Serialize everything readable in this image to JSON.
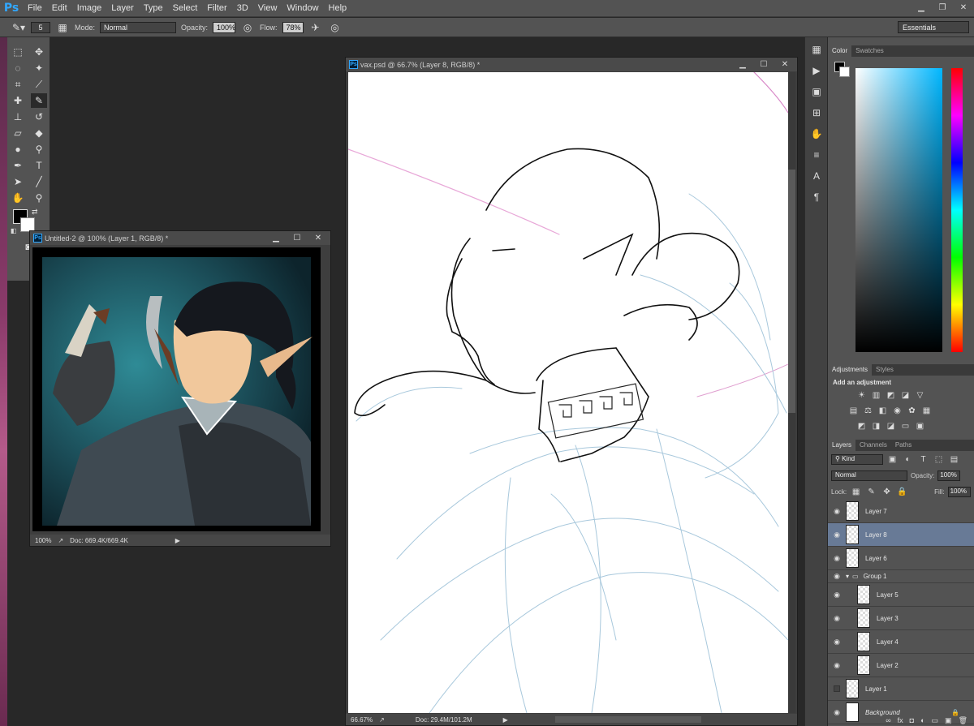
{
  "menu": {
    "logo": "Ps",
    "items": [
      "File",
      "Edit",
      "Image",
      "Layer",
      "Type",
      "Select",
      "Filter",
      "3D",
      "View",
      "Window",
      "Help"
    ]
  },
  "options": {
    "brush_size": "5",
    "mode_label": "Mode:",
    "mode_value": "Normal",
    "opacity_label": "Opacity:",
    "opacity_value": "100%",
    "flow_label": "Flow:",
    "flow_value": "78%",
    "workspace": "Essentials"
  },
  "doc_small": {
    "title": "Untitled-2 @ 100% (Layer 1, RGB/8) *",
    "zoom": "100%",
    "doc_info": "Doc: 669.4K/669.4K"
  },
  "doc_main": {
    "title": "vax.psd @ 66.7% (Layer 8, RGB/8) *",
    "zoom": "66.67%",
    "doc_info": "Doc: 29.4M/101.2M"
  },
  "color_panel": {
    "tabs": [
      "Color",
      "Swatches"
    ]
  },
  "adjust_panel": {
    "tabs": [
      "Adjustments",
      "Styles"
    ],
    "heading": "Add an adjustment"
  },
  "layers_panel": {
    "tabs": [
      "Layers",
      "Channels",
      "Paths"
    ],
    "filter": "Kind",
    "blend": "Normal",
    "opacity_label": "Opacity:",
    "opacity_value": "100%",
    "lock_label": "Lock:",
    "fill_label": "Fill:",
    "fill_value": "100%",
    "layers": [
      {
        "name": "Layer 7",
        "visible": true,
        "selected": false,
        "indent": 0
      },
      {
        "name": "Layer 8",
        "visible": true,
        "selected": true,
        "indent": 0
      },
      {
        "name": "Layer 6",
        "visible": true,
        "selected": false,
        "indent": 0
      },
      {
        "name": "Group 1",
        "visible": true,
        "selected": false,
        "indent": 0,
        "group": true
      },
      {
        "name": "Layer 5",
        "visible": true,
        "selected": false,
        "indent": 1
      },
      {
        "name": "Layer 3",
        "visible": true,
        "selected": false,
        "indent": 1
      },
      {
        "name": "Layer 4",
        "visible": true,
        "selected": false,
        "indent": 1
      },
      {
        "name": "Layer 2",
        "visible": true,
        "selected": false,
        "indent": 1
      },
      {
        "name": "Layer 1",
        "visible": false,
        "selected": false,
        "indent": 0
      },
      {
        "name": "Background",
        "visible": true,
        "selected": false,
        "indent": 0,
        "locked": true
      }
    ]
  }
}
